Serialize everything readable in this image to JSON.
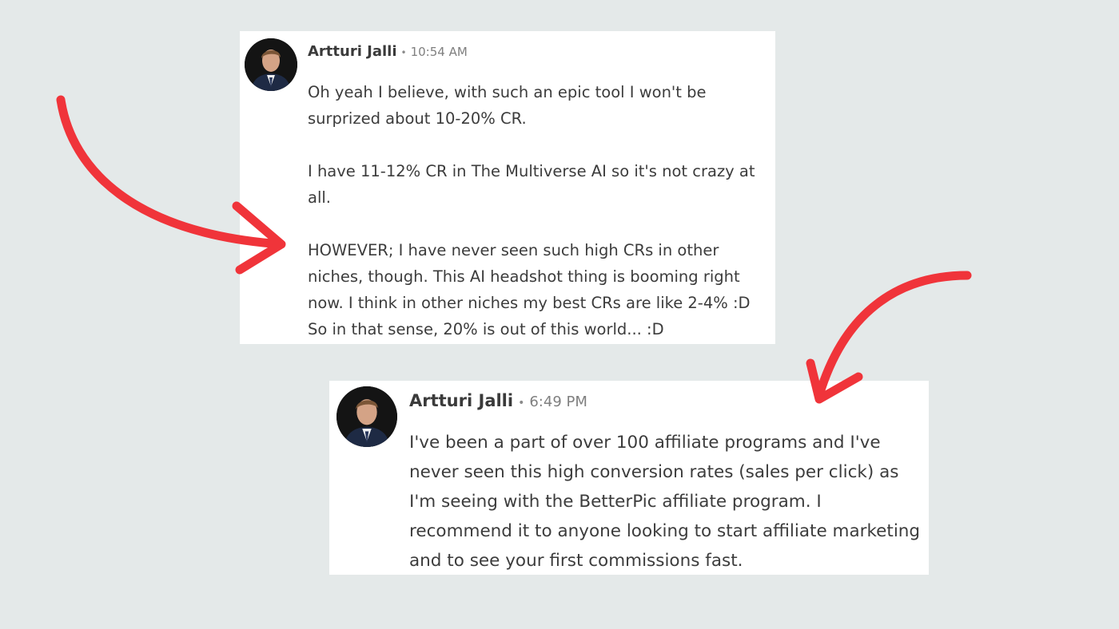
{
  "colors": {
    "background": "#e4e9e9",
    "card": "#ffffff",
    "arrow": "#f0343a",
    "text": "#3c3c3c",
    "muted": "#7f7f7f"
  },
  "messages": [
    {
      "author": "Artturi Jalli",
      "separator": "•",
      "time": "10:54 AM",
      "paragraphs": [
        "Oh yeah I believe, with such an epic tool I won't be surprized about 10-20% CR.",
        "I have 11-12% CR in The Multiverse AI so it's not crazy at all.",
        "HOWEVER; I have never seen such high CRs in other niches, though. This AI headshot thing is booming right now. I think in other niches my best CRs are like 2-4% :D So in that sense, 20% is out of this world... :D"
      ]
    },
    {
      "author": "Artturi Jalli",
      "separator": "•",
      "time": "6:49 PM",
      "paragraphs": [
        "I've been a part of over 100 affiliate programs and I've never seen this high conversion rates (sales per click) as I'm seeing with the BetterPic affiliate program. I recommend it to anyone looking to start affiliate marketing and to see your first commissions fast."
      ]
    }
  ],
  "icons": {
    "avatar": "person-avatar-icon",
    "arrow": "curved-arrow-icon"
  }
}
